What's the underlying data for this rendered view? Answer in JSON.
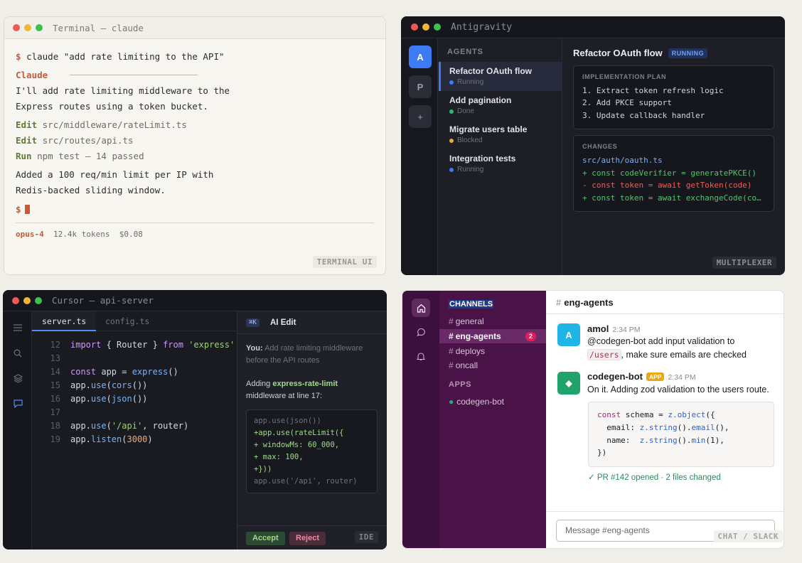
{
  "terminal": {
    "title": "Terminal — claude",
    "prompt": "$",
    "command": "claude \"add rate limiting to the API\"",
    "speaker": "Claude",
    "intro": [
      "I'll add rate limiting middleware to the",
      "Express routes using a token bucket."
    ],
    "actions": [
      {
        "verb": "Edit",
        "arg": "src/middleware/rateLimit.ts"
      },
      {
        "verb": "Edit",
        "arg": "src/routes/api.ts"
      },
      {
        "verb": "Run",
        "arg": "npm test — 14 passed"
      }
    ],
    "summary": [
      "Added a 100 req/min limit per IP with",
      "Redis-backed sliding window."
    ],
    "model": "opus-4",
    "tokens": "12.4k tokens",
    "cost": "$0.08",
    "tag": "TERMINAL UI"
  },
  "antigravity": {
    "title": "Antigravity",
    "rail": [
      "A",
      "P",
      "+"
    ],
    "agents_header": "AGENTS",
    "agents": [
      {
        "name": "Refactor OAuth flow",
        "status": "Running",
        "color": "#3d7bf4"
      },
      {
        "name": "Add pagination",
        "status": "Done",
        "color": "#2fb86a"
      },
      {
        "name": "Migrate users table",
        "status": "Blocked",
        "color": "#e2a93b"
      },
      {
        "name": "Integration tests",
        "status": "Running",
        "color": "#3d7bf4"
      }
    ],
    "detail_title": "Refactor OAuth flow",
    "detail_badge": "RUNNING",
    "plan_header": "IMPLEMENTATION PLAN",
    "plan": [
      "1. Extract token refresh logic",
      "2. Add PKCE support",
      "3. Update callback handler"
    ],
    "changes_header": "CHANGES",
    "changes_file": "src/auth/oauth.ts",
    "changes": [
      "+ const codeVerifier = generatePKCE()",
      "- const token = await getToken(code)",
      "+ const token = await exchangeCode(code, codeVerifier)"
    ],
    "tag": "MULTIPLEXER"
  },
  "ide": {
    "title": "Cursor — api-server",
    "tabs": [
      "server.ts",
      "config.ts"
    ],
    "line_numbers": [
      "12",
      "13",
      "14",
      "15",
      "16",
      "17",
      "18",
      "19"
    ],
    "code": [
      "import { Router } from 'express'",
      "",
      "const app = express()",
      "app.use(cors())",
      "app.use(json())",
      "",
      "app.use('/api', router)",
      "app.listen(3000)"
    ],
    "shortcut": "⌘K",
    "panel_title": "AI Edit",
    "you_label": "You:",
    "you_text": "Add rate limiting middleware before the API routes",
    "reply_prefix": "Adding",
    "reply_pkg": "express-rate-limit",
    "reply_suffix": "middleware at line 17:",
    "diff": [
      "app.use(json())",
      "+app.use(rateLimit({",
      "+ windowMs: 60_000,",
      "+ max: 100,",
      "+}))",
      "app.use('/api', router)"
    ],
    "accept": "Accept",
    "reject": "Reject",
    "tag": "IDE"
  },
  "slack": {
    "channels_header": "CHANNELS",
    "channels": [
      {
        "name": "general",
        "active": false
      },
      {
        "name": "eng-agents",
        "active": true,
        "badge": "2"
      },
      {
        "name": "deploys",
        "active": false
      },
      {
        "name": "oncall",
        "active": false
      }
    ],
    "apps_header": "APPS",
    "apps": [
      "codegen-bot"
    ],
    "channel_title": "eng-agents",
    "messages": [
      {
        "avatar": "A",
        "user": "amol",
        "time": "2:34 PM",
        "text_a": "@codegen-bot add input validation to",
        "code": "/users",
        "text_b": ", make sure emails are checked"
      },
      {
        "avatar": "◆",
        "user": "codegen-bot",
        "app_tag": "APP",
        "time": "2:34 PM",
        "text": "On it. Adding zod validation to the users route."
      }
    ],
    "code_block": [
      "const schema = z.object({",
      "  email: z.string().email(),",
      "  name:  z.string().min(1),",
      "})"
    ],
    "pr_status": "✓ PR #142 opened · 2 files changed",
    "input_placeholder": "Message #eng-agents",
    "tag": "CHAT / SLACK"
  },
  "colors": {
    "accent_terminal": "#c55b3b",
    "accent_blue": "#3d7bf4",
    "slack_aubergine": "#4a1348",
    "slack_badge": "#e01e5a"
  }
}
